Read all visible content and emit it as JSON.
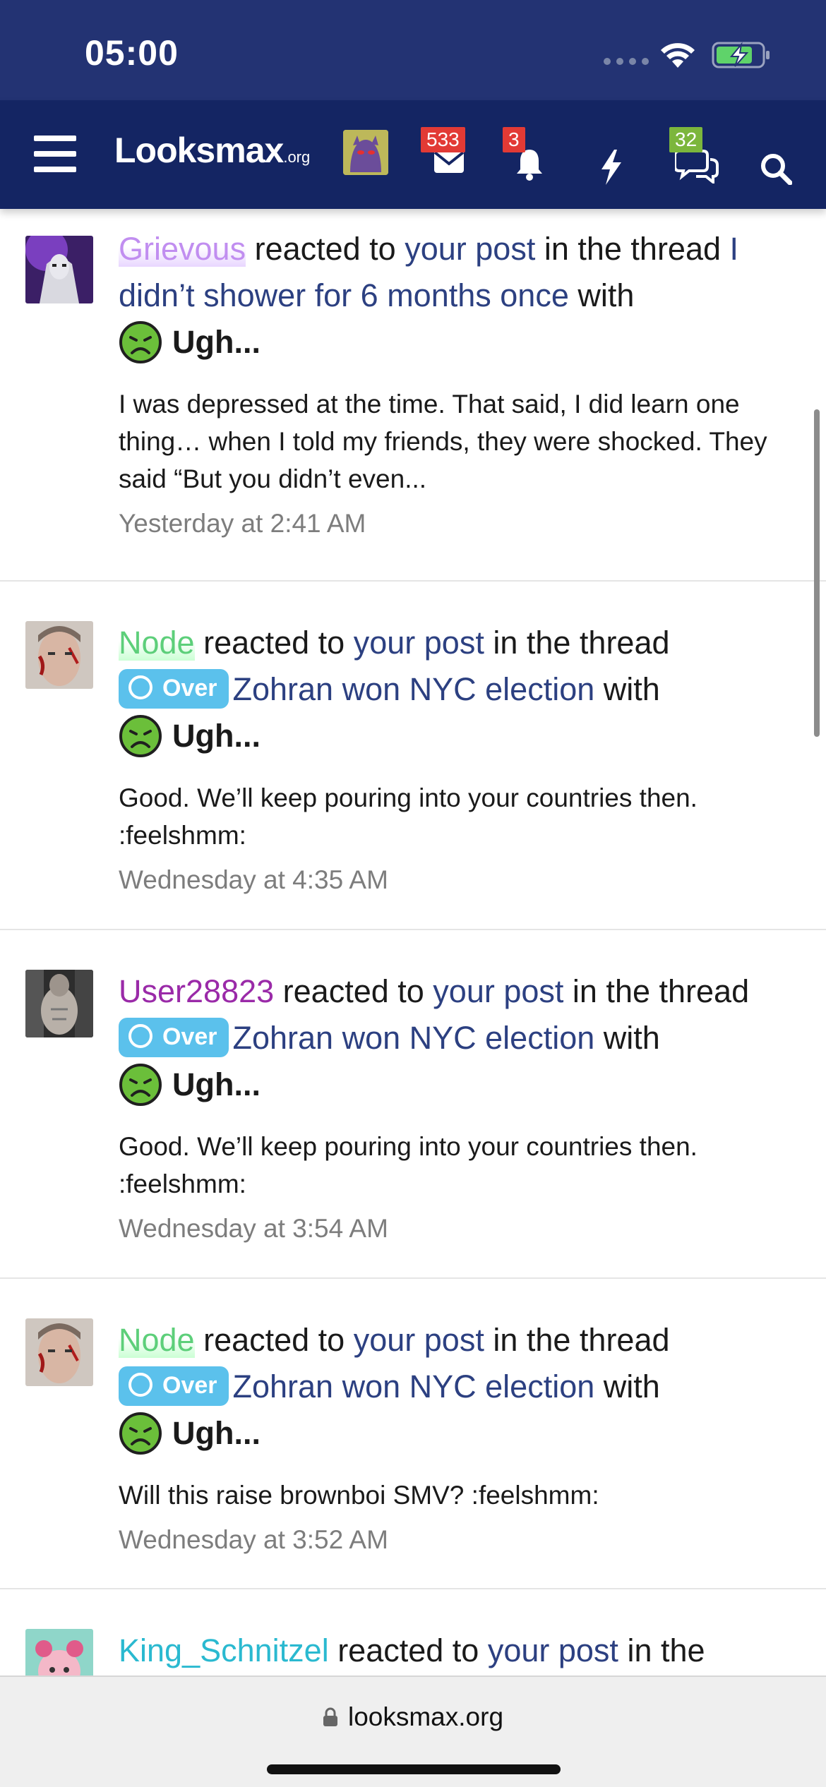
{
  "status_bar": {
    "time": "05:00"
  },
  "nav": {
    "logo_main": "Looksmax",
    "logo_suffix": ".org",
    "messages_count": "533",
    "alerts_count": "3",
    "conversations_count": "32"
  },
  "feed": [
    {
      "user": "Grievous",
      "reacted_text": " reacted to ",
      "post_link": "your post",
      "in_thread": " in the thread ",
      "prefix": "",
      "thread_title": "I didn’t shower for 6 months once",
      "with": " with",
      "reaction": "Ugh...",
      "snippet": "I was depressed at the time. That said, I did learn one thing… when I told my friends, they were shocked. They said “But you didn’t even...",
      "time": "Yesterday at 2:41 AM"
    },
    {
      "user": "Node",
      "reacted_text": " reacted to ",
      "post_link": "your post",
      "in_thread": " in the thread",
      "prefix": "Over",
      "thread_title": "Zohran won NYC election",
      "with": " with",
      "reaction": "Ugh...",
      "snippet": "Good. We’ll keep pouring into your countries then. :feelshmm:",
      "time": "Wednesday at 4:35 AM"
    },
    {
      "user": "User28823",
      "reacted_text": " reacted to ",
      "post_link": "your post",
      "in_thread": " in the thread",
      "prefix": "Over",
      "thread_title": "Zohran won NYC election",
      "with": " with",
      "reaction": "Ugh...",
      "snippet": "Good. We’ll keep pouring into your countries then. :feelshmm:",
      "time": "Wednesday at 3:54 AM"
    },
    {
      "user": "Node",
      "reacted_text": " reacted to ",
      "post_link": "your post",
      "in_thread": " in the thread",
      "prefix": "Over",
      "thread_title": "Zohran won NYC election",
      "with": " with",
      "reaction": "Ugh...",
      "snippet": "Will this raise brownboi SMV? :feelshmm:",
      "time": "Wednesday at 3:52 AM"
    },
    {
      "user": "King_Schnitzel",
      "reacted_text": " reacted to ",
      "post_link": "your post",
      "in_thread": " in the"
    }
  ],
  "browser": {
    "url": "looksmax.org"
  },
  "colors": {
    "status_bg": "#233373",
    "nav_bg": "#142563",
    "link": "#2c4081",
    "prefix_bg": "#5bc1ec",
    "badge_red": "#e23a35",
    "badge_green": "#7cb63c"
  },
  "icons": [
    "hamburger-icon",
    "envelope-icon",
    "bell-icon",
    "bolt-icon",
    "chat-bubbles-icon",
    "search-icon",
    "sick-face-icon",
    "lock-icon",
    "wifi-icon",
    "battery-charging-icon"
  ]
}
